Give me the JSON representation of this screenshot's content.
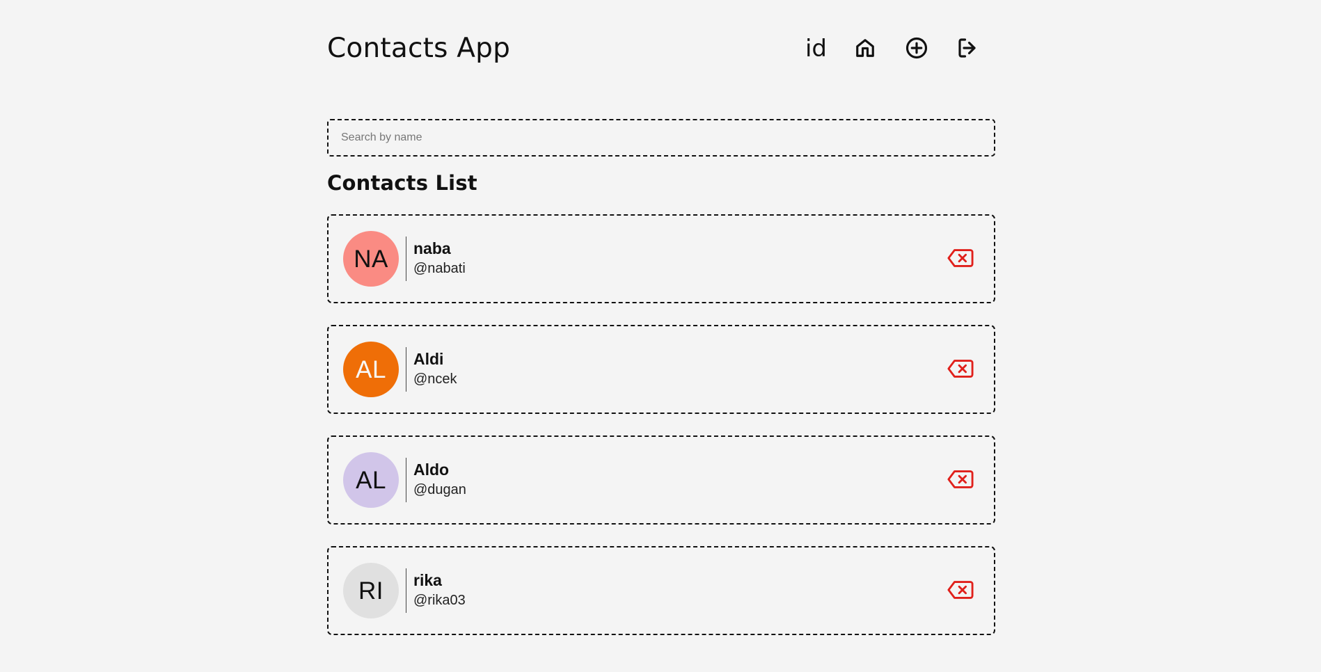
{
  "app": {
    "title": "Contacts App"
  },
  "header": {
    "nav": {
      "language": "id",
      "home_icon": "home-icon",
      "add_icon": "plus-circle-icon",
      "logout_icon": "logout-icon"
    }
  },
  "search": {
    "value": "",
    "placeholder": "Search by name"
  },
  "contacts": {
    "title": "Contacts List",
    "items": [
      {
        "initials": "NA",
        "name": "naba",
        "username": "@nabati",
        "avatar_color": "#fa8b83",
        "avatar_text_color": "#111111"
      },
      {
        "initials": "AL",
        "name": "Aldi",
        "username": "@ncek",
        "avatar_color": "#ef6e07",
        "avatar_text_color": "#f8f8f8"
      },
      {
        "initials": "AL",
        "name": "Aldo",
        "username": "@dugan",
        "avatar_color": "#d1c5e9",
        "avatar_text_color": "#111111"
      },
      {
        "initials": "RI",
        "name": "rika",
        "username": "@rika03",
        "avatar_color": "#e0e0e0",
        "avatar_text_color": "#111111"
      }
    ]
  },
  "colors": {
    "background": "#f4f4f4",
    "text": "#111111",
    "delete_accent": "#e0201b"
  }
}
